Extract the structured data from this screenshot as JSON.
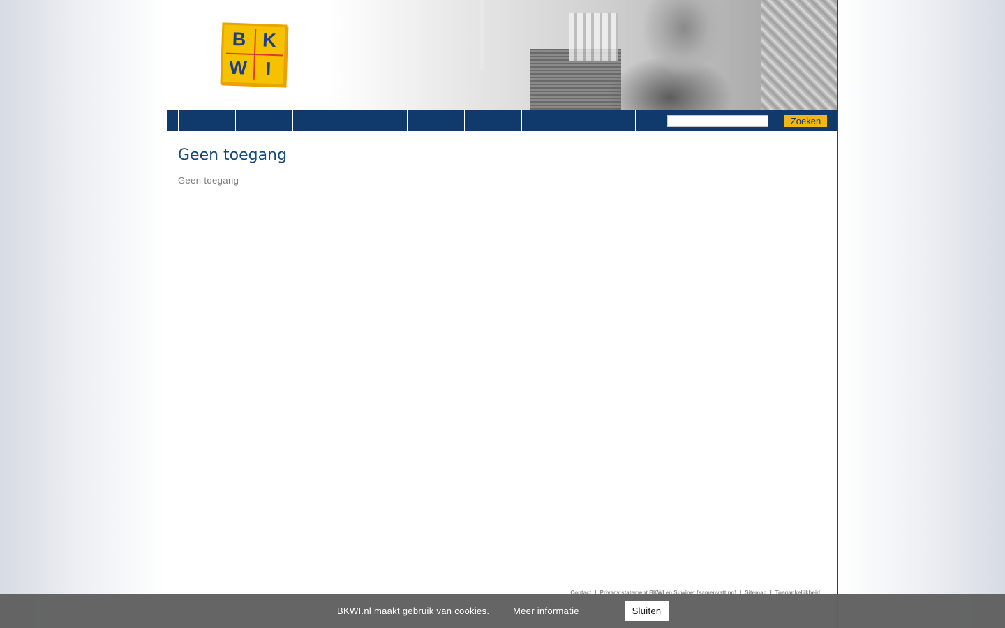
{
  "header": {
    "logo_letters": [
      "B",
      "K",
      "W",
      "I"
    ]
  },
  "nav": {
    "items": [
      "",
      "",
      "",
      "",
      "",
      "",
      "",
      ""
    ],
    "search_placeholder": "",
    "search_button": "Zoeken"
  },
  "main": {
    "title": "Geen toegang",
    "body": "Geen toegang"
  },
  "footer": {
    "links": [
      "Contact",
      "Privacy statement BKWI en Suwinet (samenvatting)",
      "Sitemap",
      "Toegankelijkheid"
    ],
    "separator": "|"
  },
  "cookie_bar": {
    "message": "BKWI.nl maakt gebruik van cookies.",
    "more_info": "Meer informatie",
    "close": "Sluiten"
  },
  "colors": {
    "nav_blue": "#0f3a6b",
    "title_blue": "#174a7c",
    "search_button_yellow": "#f2b617",
    "logo_yellow": "#f6c200"
  }
}
